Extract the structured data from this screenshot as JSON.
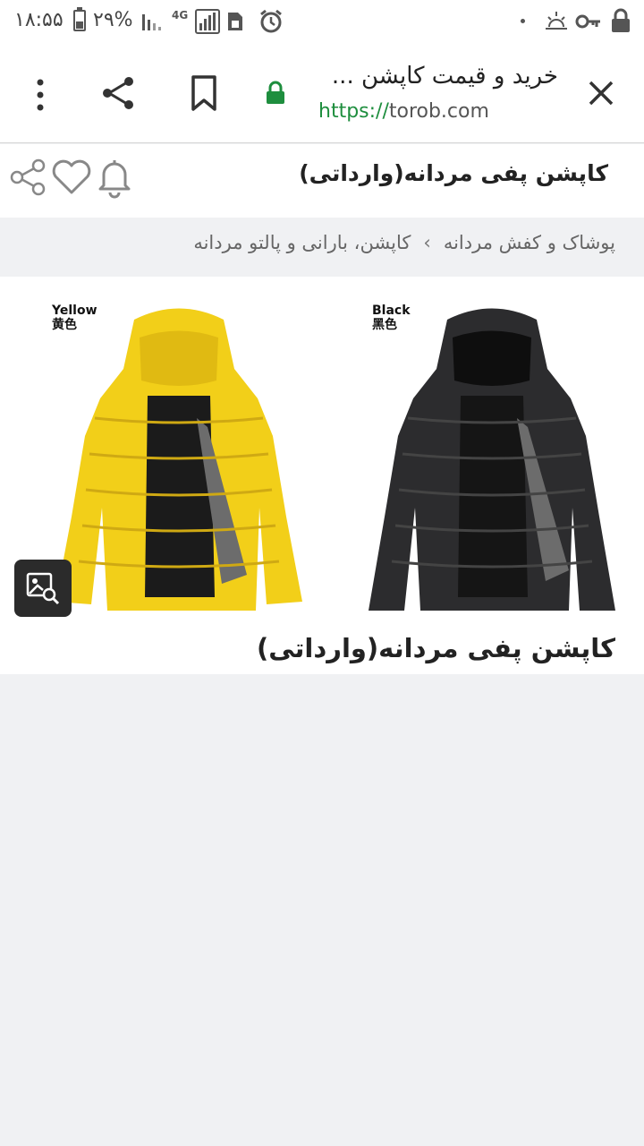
{
  "status_bar": {
    "time": "۱۸:۵۵",
    "battery_percent": "۲۹%",
    "network": "4G",
    "icons": [
      "battery-icon",
      "signal-icon",
      "network-4g-icon",
      "signal-strength-icon",
      "document-icon",
      "alarm-icon",
      "notification-dot-icon",
      "sunrise-icon",
      "key-icon",
      "lock-icon"
    ]
  },
  "browser": {
    "tab_title": "خرید و قیمت کاپشن ...",
    "url_scheme": "https://",
    "url_host": "torob.com",
    "icons": [
      "close-icon",
      "secure-lock-icon",
      "bookmark-icon",
      "share-icon",
      "more-options-icon"
    ],
    "colors": {
      "secure": "#1e8e3e"
    }
  },
  "page": {
    "header_title": "کاپشن پفی مردانه(وارداتی)",
    "header_icons": [
      "notification-bell-icon",
      "favorite-heart-icon",
      "share-icon"
    ],
    "breadcrumb": {
      "level1": "پوشاک و کفش مردانه",
      "separator": "›",
      "level2": "کاپشن، بارانی و پالتو مردانه"
    },
    "gallery": {
      "images": [
        {
          "color_en": "Black",
          "color_zh": "黑色",
          "fill": "#2c2c2e"
        },
        {
          "color_en": "Yellow",
          "color_zh": "黄色",
          "fill": "#f2cf19"
        }
      ],
      "search_icon": "image-search-icon"
    },
    "product_name": "کاپشن پفی مردانه(وارداتی)"
  }
}
